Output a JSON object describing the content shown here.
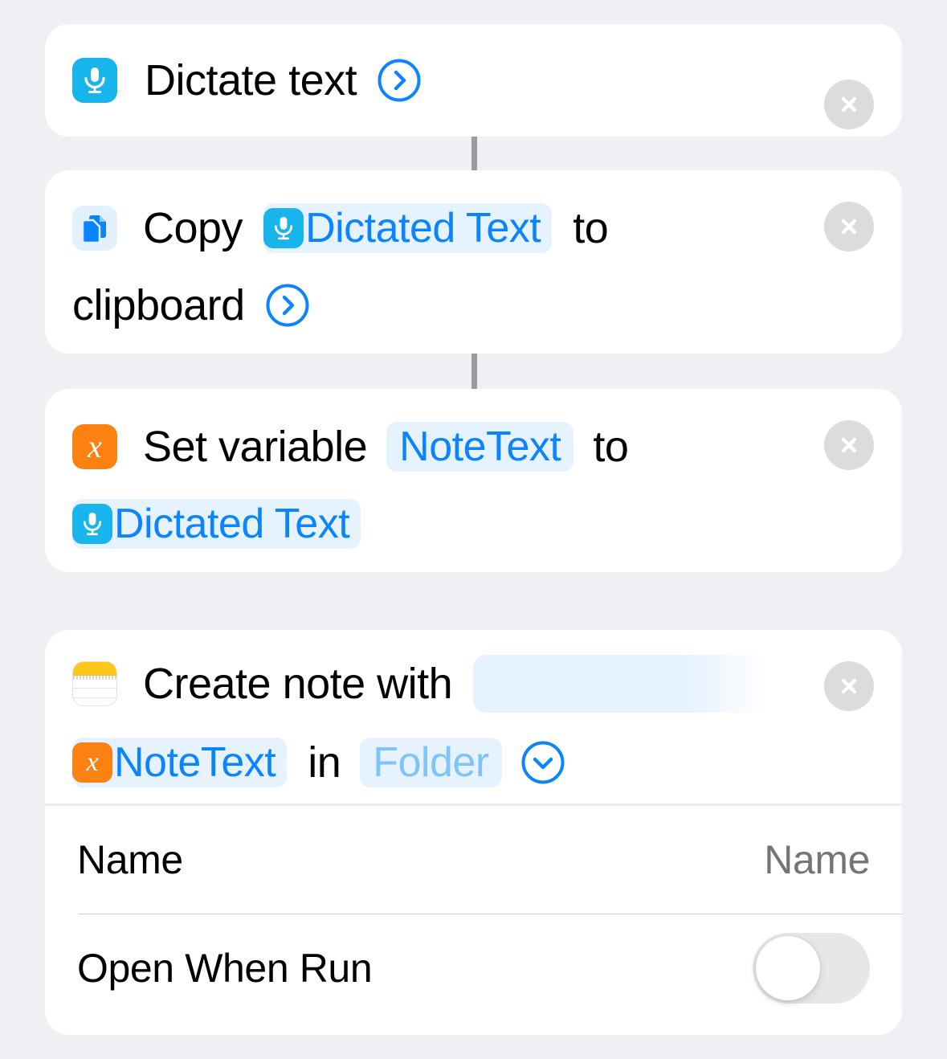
{
  "theme": {
    "background": "#F0F0F4",
    "card_background": "#FFFFFF",
    "accent_blue": "#0A84FF",
    "token_background": "#E6F2FE",
    "mic_icon_color": "#18B5EC",
    "variable_icon_color": "#FB8112",
    "notes_icon_color": "#FCC719",
    "close_button_color": "#DCDCDE",
    "connector_color": "#9A9AA3",
    "placeholder_text_color": "#BFBFC2",
    "muted_token_text_color": "#7FC3FB"
  },
  "actions": [
    {
      "id": "dictate-text",
      "icon": "microphone-icon",
      "text_before": "Dictate text",
      "has_chevron": true,
      "chevron": "chevron-right-circle-icon",
      "close_label": "×"
    },
    {
      "id": "copy-to-clipboard",
      "icon": "copy-icon",
      "text_before": "Copy",
      "token": {
        "icon": "microphone-icon",
        "label": "Dictated Text"
      },
      "text_middle": "to",
      "text_after": "clipboard",
      "has_chevron": true,
      "chevron": "chevron-right-circle-icon",
      "close_label": "×"
    },
    {
      "id": "set-variable",
      "icon": "variable-icon",
      "text_before": "Set variable",
      "token": {
        "icon": null,
        "label": "NoteText"
      },
      "text_middle": "to",
      "token2": {
        "icon": "microphone-icon",
        "label": "Dictated Text"
      },
      "has_chevron": false,
      "close_label": "×"
    },
    {
      "id": "create-note",
      "icon": "notes-icon",
      "text_before": "Create note with",
      "empty_field_placeholder": "",
      "token": {
        "icon": "variable-icon",
        "label": "NoteText"
      },
      "text_middle": "in",
      "token2": {
        "icon": null,
        "label": "Folder",
        "muted": true
      },
      "has_chevron": true,
      "chevron": "chevron-down-circle-icon",
      "close_label": "×",
      "parameters": [
        {
          "id": "name",
          "label": "Name",
          "type": "text",
          "value": "",
          "placeholder": "Name"
        },
        {
          "id": "open-when-run",
          "label": "Open When Run",
          "type": "toggle",
          "value": "off"
        }
      ]
    }
  ]
}
